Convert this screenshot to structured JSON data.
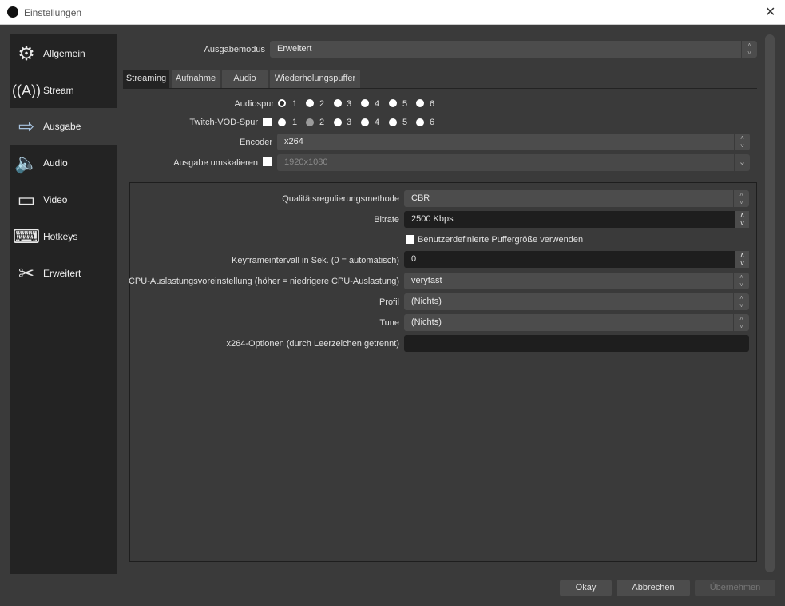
{
  "window": {
    "title": "Einstellungen"
  },
  "sidebar": {
    "items": [
      {
        "label": "Allgemein",
        "icon": "gear-icon"
      },
      {
        "label": "Stream",
        "icon": "antenna-icon"
      },
      {
        "label": "Ausgabe",
        "icon": "monitor-arrow-icon"
      },
      {
        "label": "Audio",
        "icon": "speaker-icon"
      },
      {
        "label": "Video",
        "icon": "monitor-icon"
      },
      {
        "label": "Hotkeys",
        "icon": "keyboard-icon"
      },
      {
        "label": "Erweitert",
        "icon": "tools-icon"
      }
    ],
    "selected": "Ausgabe"
  },
  "output_mode": {
    "label": "Ausgabemodus",
    "value": "Erweitert"
  },
  "tabs": [
    "Streaming",
    "Aufnahme",
    "Audio",
    "Wiederholungspuffer"
  ],
  "audio_track": {
    "label": "Audiospur",
    "options": [
      "1",
      "2",
      "3",
      "4",
      "5",
      "6"
    ],
    "selected": "1"
  },
  "twitch_vod": {
    "label": "Twitch-VOD-Spur",
    "options": [
      "1",
      "2",
      "3",
      "4",
      "5",
      "6"
    ],
    "disabled": "2"
  },
  "encoder": {
    "label": "Encoder",
    "value": "x264"
  },
  "rescale": {
    "label": "Ausgabe umskalieren",
    "value": "1920x1080"
  },
  "settings": {
    "rate_control": {
      "label": "Qualitätsregulierungsmethode",
      "value": "CBR"
    },
    "bitrate": {
      "label": "Bitrate",
      "value": "2500 Kbps"
    },
    "custom_buffer": {
      "label": "Benutzerdefinierte Puffergröße verwenden"
    },
    "keyframe": {
      "label": "Keyframeintervall in Sek. (0 = automatisch)",
      "value": "0"
    },
    "cpu_preset": {
      "label": "CPU-Auslastungsvoreinstellung (höher = niedrigere CPU-Auslastung)",
      "value": "veryfast"
    },
    "profile": {
      "label": "Profil",
      "value": "(Nichts)"
    },
    "tune": {
      "label": "Tune",
      "value": "(Nichts)"
    },
    "x264_options": {
      "label": "x264-Optionen (durch Leerzeichen getrennt)",
      "value": ""
    }
  },
  "buttons": {
    "ok": "Okay",
    "cancel": "Abbrechen",
    "apply": "Übernehmen"
  }
}
